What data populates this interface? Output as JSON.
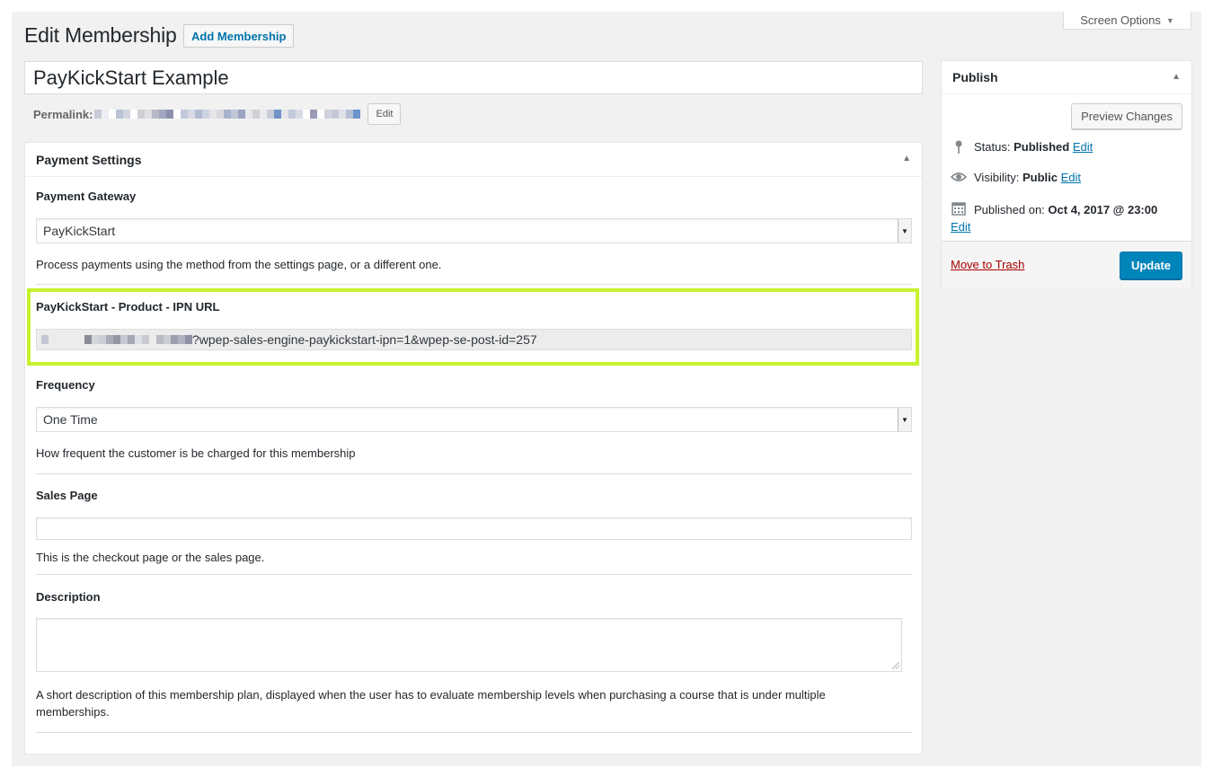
{
  "header": {
    "screen_options_label": "Screen Options",
    "page_title": "Edit Membership",
    "add_button_label": "Add Membership"
  },
  "post": {
    "title": "PayKickStart Example",
    "permalink_label": "Permalink:",
    "permalink_edit_label": "Edit"
  },
  "payment_settings": {
    "box_title": "Payment Settings",
    "gateway": {
      "label": "Payment Gateway",
      "selected": "PayKickStart",
      "description": "Process payments using the method from the settings page, or a different one."
    },
    "ipn": {
      "label": "PayKickStart - Product - IPN URL",
      "value_visible_suffix": "?wpep-sales-engine-paykickstart-ipn=1&wpep-se-post-id=257"
    },
    "frequency": {
      "label": "Frequency",
      "selected": "One Time",
      "description": "How frequent the customer is be charged for this membership"
    },
    "sales_page": {
      "label": "Sales Page",
      "value": "",
      "description": "This is the checkout page or the sales page."
    },
    "description_field": {
      "label": "Description",
      "value": "",
      "description": "A short description of this membership plan, displayed when the user has to evaluate membership levels when purchasing a course that is under multiple memberships."
    }
  },
  "publish": {
    "box_title": "Publish",
    "preview_label": "Preview Changes",
    "status_label": "Status:",
    "status_value": "Published",
    "visibility_label": "Visibility:",
    "visibility_value": "Public",
    "published_on_label": "Published on:",
    "published_on_value": "Oct 4, 2017 @ 23:00",
    "edit_label": "Edit",
    "trash_label": "Move to Trash",
    "update_label": "Update"
  },
  "colors": {
    "link": "#0073aa",
    "primary_button": "#0085ba",
    "trash": "#aa0000",
    "highlight_border": "#c6f22e"
  },
  "icons": {
    "status": "pin-icon",
    "visibility": "eye-icon",
    "published_on": "calendar-icon"
  }
}
